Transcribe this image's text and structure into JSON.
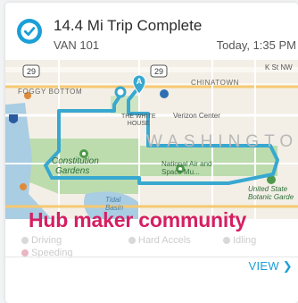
{
  "trip": {
    "title": "14.4 Mi Trip Complete",
    "vehicle": "VAN 101",
    "time": "Today, 1:35 PM"
  },
  "map": {
    "shields": [
      "29",
      "29"
    ],
    "labels": {
      "k_st": "K St NW",
      "foggy_bottom": "FOGGY BOTTOM",
      "chinatown": "CHINATOWN",
      "white_house_line1": "THE WHITE",
      "white_house_line2": "HOUSE",
      "verizon": "Verizon Center",
      "washington": "WASHINGTO",
      "constitution_line1": "Constitution",
      "constitution_line2": "Gardens",
      "national_air_line1": "National Air and",
      "national_air_line2": "Space Mu...",
      "tidal_line1": "Tidal",
      "tidal_line2": "Basin",
      "botanic_line1": "United State",
      "botanic_line2": "Botanic Garde"
    },
    "start_marker": "A",
    "route_color": "#38a8d0",
    "park_color": "#bcdcae"
  },
  "legend": {
    "items": [
      "Driving",
      "Hard Accels",
      "Idling",
      "Speeding"
    ]
  },
  "overlay": {
    "title": "Hub maker community"
  },
  "footer": {
    "view_label": "VIEW ❯"
  },
  "colors": {
    "accent": "#1a9fd6",
    "overlay": "#d61f63"
  }
}
